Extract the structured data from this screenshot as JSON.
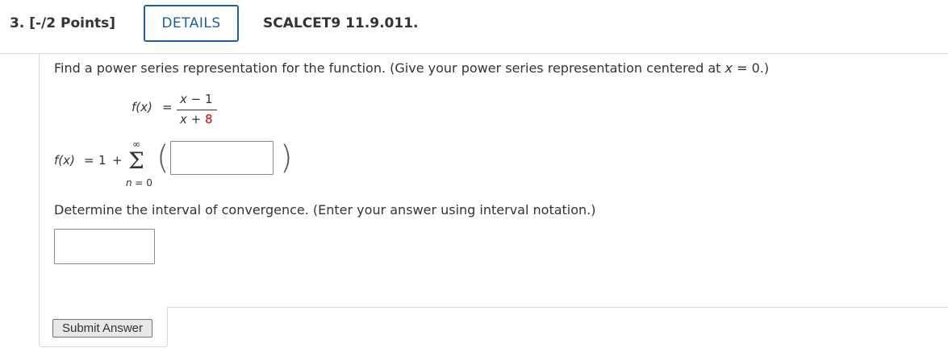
{
  "header": {
    "question_label": "3. [-/2 Points]",
    "details_label": "DETAILS",
    "question_code": "SCALCET9 11.9.011."
  },
  "prompt": {
    "pre": "Find a power series representation for the function. (Give your power series representation centered at ",
    "var": "x",
    "post": " = 0.)"
  },
  "function": {
    "lhs": "f(x)",
    "equals": "=",
    "numerator_var": "x",
    "numerator_rest": " − 1",
    "denominator_var": "x",
    "denominator_op": " + ",
    "denominator_const": "8"
  },
  "series": {
    "lhs": "f(x)",
    "equals": "=",
    "constant_term": "1",
    "plus": "+",
    "sum_upper": "∞",
    "sum_symbol": "Σ",
    "index_var": "n",
    "index_start": " = 0",
    "open_paren": "(",
    "close_paren": ")",
    "term_value": ""
  },
  "interval": {
    "prompt": "Determine the interval of convergence. (Enter your answer using interval notation.)",
    "value": ""
  },
  "submit_label": "Submit Answer",
  "colors": {
    "accent": "#1f5f9a",
    "highlight": "#cc0000"
  }
}
